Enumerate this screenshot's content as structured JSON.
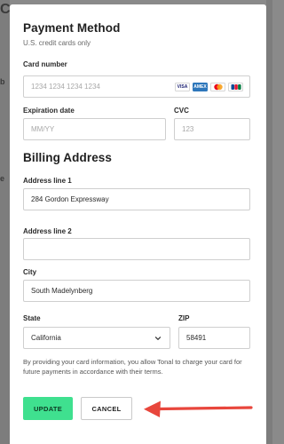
{
  "payment": {
    "title": "Payment Method",
    "subtitle": "U.S. credit cards only",
    "card_number_label": "Card number",
    "card_number_placeholder": "1234 1234 1234 1234",
    "card_brands": [
      "VISA",
      "AMEX",
      "MC",
      "JCB"
    ],
    "expiration_label": "Expiration date",
    "expiration_placeholder": "MM/YY",
    "cvc_label": "CVC",
    "cvc_placeholder": "123"
  },
  "billing": {
    "title": "Billing Address",
    "address1_label": "Address line 1",
    "address1_value": "284 Gordon Expressway",
    "address2_label": "Address line 2",
    "address2_value": "",
    "city_label": "City",
    "city_value": "South Madelynberg",
    "state_label": "State",
    "state_value": "California",
    "zip_label": "ZIP",
    "zip_value": "58491"
  },
  "disclaimer": "By providing your card information, you allow Tonal to charge your card for future payments in accordance with their terms.",
  "actions": {
    "update_label": "UPDATE",
    "cancel_label": "CANCEL"
  },
  "colors": {
    "update_bg": "#3fe08f",
    "arrow": "#e8463c",
    "overlay": "#8a8a8a"
  }
}
